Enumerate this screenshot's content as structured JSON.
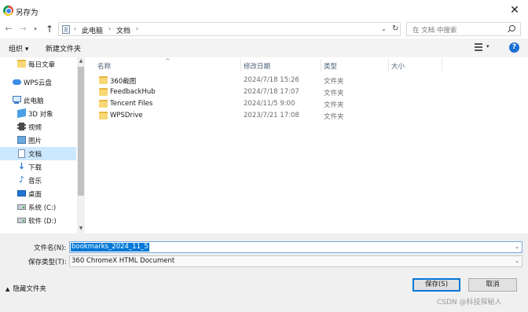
{
  "window": {
    "title": "另存为"
  },
  "nav": {
    "breadcrumb": [
      "此电脑",
      "文档"
    ],
    "search_placeholder": "在 文档 中搜索"
  },
  "toolbar": {
    "organize": "组织 ▾",
    "new_folder": "新建文件夹"
  },
  "sidebar": {
    "items": [
      {
        "label": "每日文章",
        "icon": "folder-icon"
      },
      {
        "label": "WPS云盘",
        "icon": "cloud-icon"
      },
      {
        "label": "此电脑",
        "icon": "computer-icon"
      },
      {
        "label": "3D 对象",
        "icon": "3d-objects-icon"
      },
      {
        "label": "视频",
        "icon": "video-icon"
      },
      {
        "label": "图片",
        "icon": "pictures-icon"
      },
      {
        "label": "文档",
        "icon": "documents-icon",
        "selected": true
      },
      {
        "label": "下载",
        "icon": "download-icon"
      },
      {
        "label": "音乐",
        "icon": "music-icon"
      },
      {
        "label": "桌面",
        "icon": "desktop-icon"
      },
      {
        "label": "系统 (C:)",
        "icon": "drive-icon"
      },
      {
        "label": "软件 (D:)",
        "icon": "drive-icon"
      }
    ]
  },
  "filelist": {
    "columns": [
      "名称",
      "修改日期",
      "类型",
      "大小"
    ],
    "rows": [
      {
        "name": "360截图",
        "date": "2024/7/18 15:26",
        "type": "文件夹"
      },
      {
        "name": "FeedbackHub",
        "date": "2024/7/18 17:07",
        "type": "文件夹"
      },
      {
        "name": "Tencent Files",
        "date": "2024/11/5 9:00",
        "type": "文件夹"
      },
      {
        "name": "WPSDrive",
        "date": "2023/7/21 17:08",
        "type": "文件夹"
      }
    ]
  },
  "save": {
    "filename_label": "文件名(N):",
    "filename_value": "bookmarks_2024_11_5",
    "filetype_label": "保存类型(T):",
    "filetype_value": "360 ChromeX HTML Document",
    "hide_folders": "隐藏文件夹",
    "save_button": "保存(S)",
    "cancel_button": "取消"
  },
  "watermark": "CSDN @科技探秘人"
}
